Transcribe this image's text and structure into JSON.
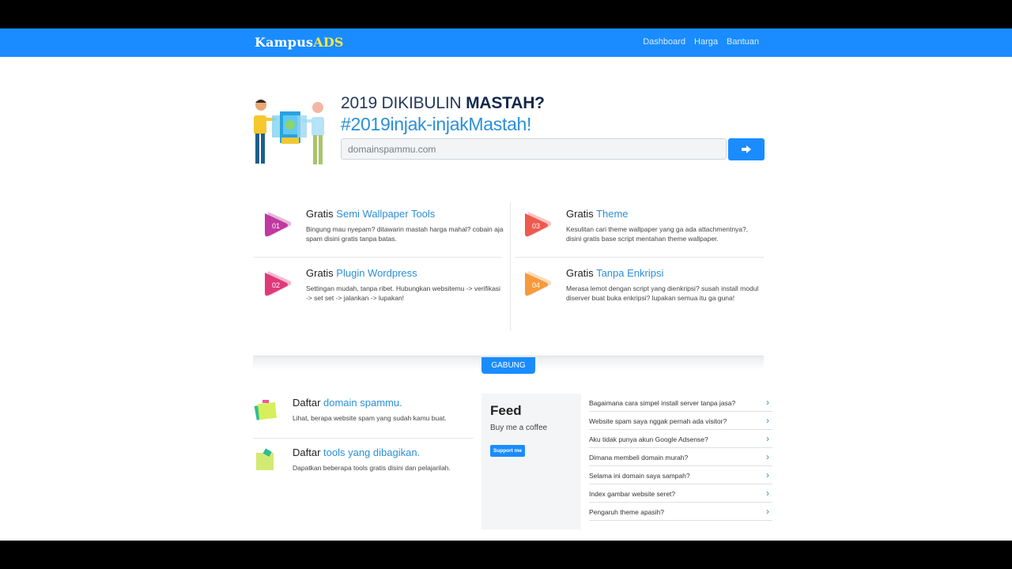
{
  "navbar": {
    "brand_main": "Kampus",
    "brand_accent": "ADS",
    "links": [
      "Dashboard",
      "Harga",
      "Bantuan"
    ]
  },
  "hero": {
    "title_prefix": "2019 DIKIBULIN ",
    "title_bold": "MASTAH?",
    "subtitle": "#2019injak-injakMastah!",
    "input_placeholder": "domainspammu.com",
    "submit_icon": "arrow-right-icon"
  },
  "features": [
    {
      "num": "01",
      "prefix": "Gratis ",
      "highlight": "Semi Wallpaper Tools",
      "desc": "Bingung mau nyepam? ditawarin mastah harga mahal? cobain aja spam disini gratis tanpa batas.",
      "color": "#c0399f"
    },
    {
      "num": "02",
      "prefix": "Gratis ",
      "highlight": "Plugin Wordpress",
      "desc": "Settingan mudah, tanpa ribet. Hubungkan websitemu -> verifikasi -> set set -> jalankan -> lupakan!",
      "color": "#e0397a"
    },
    {
      "num": "03",
      "prefix": "Gratis ",
      "highlight": "Theme",
      "desc": "Kesulitan cari theme wallpaper yang ga ada attachmentnya?, disini gratis base script mentahan theme wallpaper.",
      "color": "#ef5a4e"
    },
    {
      "num": "04",
      "prefix": "Gratis ",
      "highlight": "Tanpa Enkripsi",
      "desc": "Merasa lemot dengan script yang dienkripsi? susah install modul diserver buat buka enkripsi? lupakan semua itu ga guna!",
      "color": "#f79a3b"
    }
  ],
  "gabung": {
    "label": "GABUNG"
  },
  "daftar": [
    {
      "prefix": "Daftar ",
      "highlight": "domain spammu.",
      "desc": "Lihat, berapa website spam yang sudah kamu buat.",
      "icon": "sticky-note-icon"
    },
    {
      "prefix": "Daftar ",
      "highlight": "tools yang dibagikan.",
      "desc": "Dapatkan beberapa tools gratis disini dan pelajarilah.",
      "icon": "note-icon"
    }
  ],
  "feed": {
    "title": "Feed",
    "subtitle": "Buy me a coffee",
    "button": "Support me"
  },
  "faq": [
    "Bagaimana cara simpel install server tanpa jasa?",
    "Website spam saya nggak pernah ada visitor?",
    "Aku tidak punya akun Google Adsense?",
    "Dimana membeli domain murah?",
    "Selama ini domain saya sampah?",
    "Index gambar website seret?",
    "Pengaruh theme apasih?"
  ]
}
